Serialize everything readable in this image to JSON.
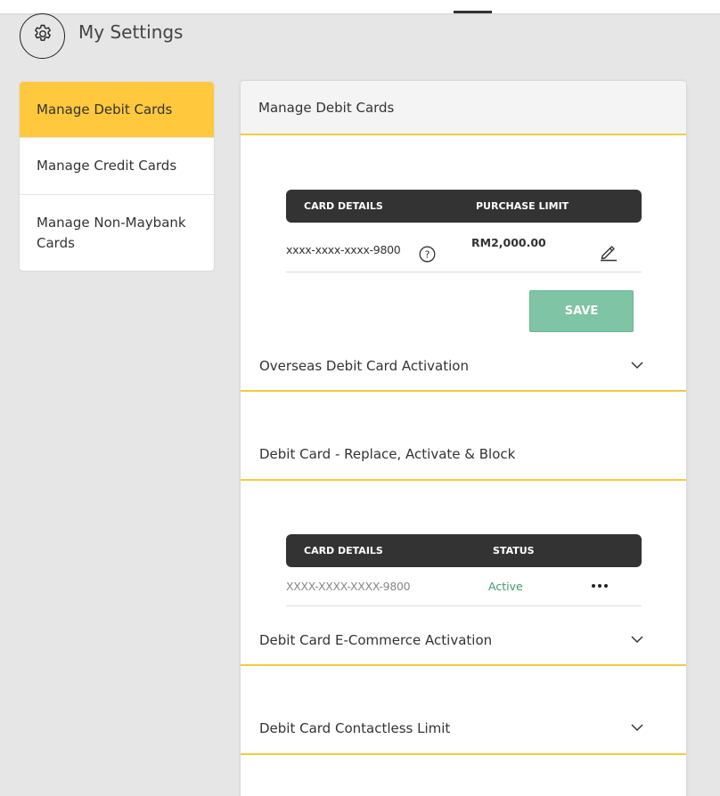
{
  "header": {
    "title": "My Settings",
    "icon": "gear-icon"
  },
  "sidebar": {
    "items": [
      {
        "label": "Manage Debit Cards",
        "active": true
      },
      {
        "label": "Manage Credit Cards",
        "active": false
      },
      {
        "label": "Manage Non-Maybank Cards",
        "active": false
      }
    ]
  },
  "main": {
    "title": "Manage Debit Cards",
    "purchase_table": {
      "headers": [
        "CARD DETAILS",
        "PURCHASE LIMIT"
      ],
      "row": {
        "card": "xxxx-xxxx-xxxx-9800",
        "limit": "RM2,000.00"
      }
    },
    "save_label": "SAVE",
    "sections": {
      "overseas": "Overseas Debit Card Activation",
      "replace": "Debit Card - Replace, Activate & Block",
      "ecommerce": "Debit Card E-Commerce Activation",
      "contactless": "Debit Card Contactless Limit"
    },
    "status_table": {
      "headers": [
        "CARD DETAILS",
        "STATUS"
      ],
      "row": {
        "card": "XXXX-XXXX-XXXX-9800",
        "status": "Active"
      }
    }
  },
  "colors": {
    "accent": "#ffc83d",
    "divider": "#f2cc3c",
    "save": "#7fc4a4",
    "active_status": "#3f9a6c",
    "table_head": "#333333"
  }
}
